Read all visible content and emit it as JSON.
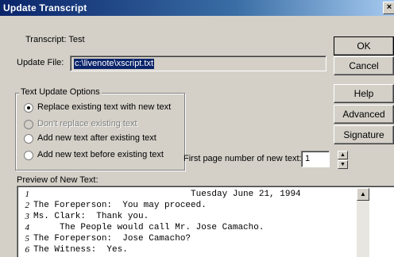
{
  "window": {
    "title": "Update Transcript",
    "close_glyph": "×"
  },
  "transcript": {
    "label": "Transcript: Test"
  },
  "update_file": {
    "label": "Update File:",
    "value": "c:\\livenote\\xscript.txt"
  },
  "buttons": {
    "ok": "OK",
    "cancel": "Cancel",
    "help": "Help",
    "advanced": "Advanced",
    "signature": "Signature"
  },
  "options": {
    "legend": "Text Update Options",
    "items": [
      {
        "label": "Replace existing text with new text",
        "checked": true,
        "disabled": false
      },
      {
        "label": "Don't replace existing text",
        "checked": false,
        "disabled": true
      },
      {
        "label": "Add new text after existing text",
        "checked": false,
        "disabled": false
      },
      {
        "label": "Add new text before existing text",
        "checked": false,
        "disabled": false
      }
    ]
  },
  "first_page": {
    "label": "First page number of new text:",
    "value": "1"
  },
  "preview": {
    "label": "Preview of New Text:",
    "lines": [
      {
        "num": "1",
        "text": "                              Tuesday June 21, 1994"
      },
      {
        "num": "2",
        "text": "The Foreperson:  You may proceed."
      },
      {
        "num": "3",
        "text": "Ms. Clark:  Thank you."
      },
      {
        "num": "4",
        "text": "     The People would call Mr. Jose Camacho."
      },
      {
        "num": "5",
        "text": "The Foreperson:  Jose Camacho?"
      },
      {
        "num": "6",
        "text": "The Witness:  Yes."
      }
    ]
  },
  "icons": {
    "spin_up": "up-arrow-icon",
    "spin_down": "down-arrow-icon",
    "scroll_up": "scroll-up-arrow-icon"
  }
}
